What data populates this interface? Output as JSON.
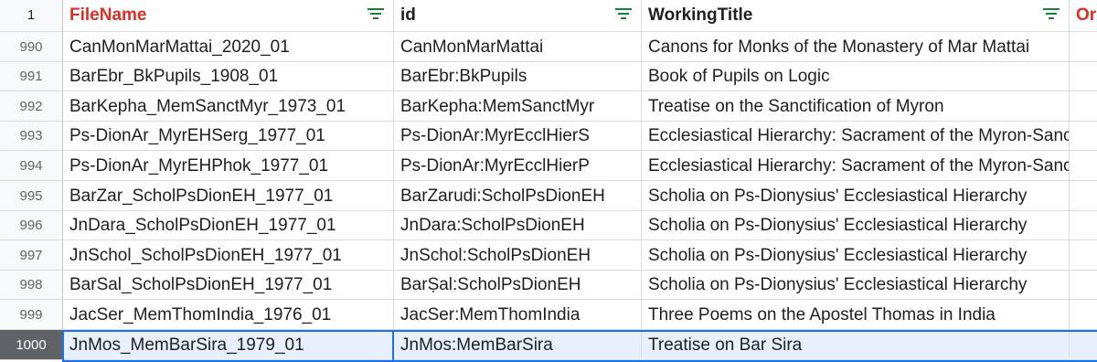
{
  "sheet": {
    "header_row_number": "1",
    "columns": [
      "FileName",
      "id",
      "WorkingTitle",
      "Or"
    ],
    "column_colors": [
      "#d93025",
      "#1f1f1f",
      "#1f1f1f",
      "#d93025"
    ],
    "filter_icon": "filter-icon",
    "filter_color": "#188038",
    "rows": [
      {
        "num": "990",
        "cells": [
          "CanMonMarMattai_2020_01",
          "CanMonMarMattai",
          "Canons for Monks of the Monastery of Mar Mattai",
          ""
        ]
      },
      {
        "num": "991",
        "cells": [
          "BarEbr_BkPupils_1908_01",
          "BarEbr:BkPupils",
          "Book of Pupils on Logic",
          ""
        ]
      },
      {
        "num": "992",
        "cells": [
          "BarKepha_MemSanctMyr_1973_01",
          "BarKepha:MemSanctMyr",
          "Treatise on the Sanctification of Myron",
          ""
        ]
      },
      {
        "num": "993",
        "cells": [
          "Ps-DionAr_MyrEHSerg_1977_01",
          "Ps-DionAr:MyrEcclHierS",
          "Ecclesiastical Hierarchy: Sacrament of the Myron-Sanc",
          ""
        ]
      },
      {
        "num": "994",
        "cells": [
          "Ps-DionAr_MyrEHPhok_1977_01",
          "Ps-DionAr:MyrEcclHierP",
          "Ecclesiastical Hierarchy: Sacrament of the Myron-Sanc",
          ""
        ]
      },
      {
        "num": "995",
        "cells": [
          "BarZar_ScholPsDionEH_1977_01",
          "BarZarudi:ScholPsDionEH",
          "Scholia on Ps-Dionysius' Ecclesiastical Hierarchy",
          ""
        ]
      },
      {
        "num": "996",
        "cells": [
          "JnDara_ScholPsDionEH_1977_01",
          "JnDara:ScholPsDionEH",
          "Scholia on Ps-Dionysius' Ecclesiastical Hierarchy",
          ""
        ]
      },
      {
        "num": "997",
        "cells": [
          "JnSchol_ScholPsDionEH_1977_01",
          "JnSchol:ScholPsDionEH",
          "Scholia on Ps-Dionysius' Ecclesiastical Hierarchy",
          ""
        ]
      },
      {
        "num": "998",
        "cells": [
          "BarSal_ScholPsDionEH_1977_01",
          "BarṢal:ScholPsDionEH",
          "Scholia on Ps-Dionysius' Ecclesiastical Hierarchy",
          ""
        ]
      },
      {
        "num": "999",
        "cells": [
          "JacSer_MemThomIndia_1976_01",
          "JacSer:MemThomIndia",
          "Three Poems on the Apostel Thomas in India",
          ""
        ]
      },
      {
        "num": "1000",
        "cells": [
          "JnMos_MemBarSira_1979_01",
          "JnMos:MemBarSira",
          "Treatise on Bar Sira",
          ""
        ]
      }
    ],
    "selected_row_index": 10,
    "selection_color": "#1a73e8"
  }
}
